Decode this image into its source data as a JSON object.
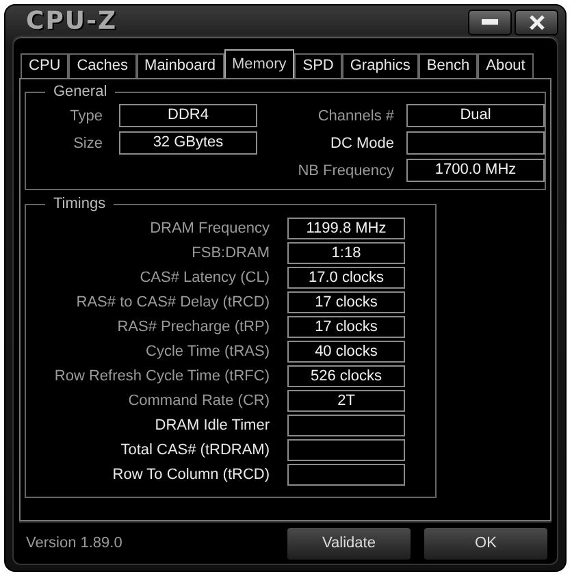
{
  "window": {
    "title": "CPU-Z"
  },
  "tabs": [
    {
      "label": "CPU",
      "selected": false
    },
    {
      "label": "Caches",
      "selected": false
    },
    {
      "label": "Mainboard",
      "selected": false
    },
    {
      "label": "Memory",
      "selected": true
    },
    {
      "label": "SPD",
      "selected": false
    },
    {
      "label": "Graphics",
      "selected": false
    },
    {
      "label": "Bench",
      "selected": false
    },
    {
      "label": "About",
      "selected": false
    }
  ],
  "general": {
    "title": "General",
    "left": [
      {
        "label": "Type",
        "value": "DDR4",
        "dimmed": true
      },
      {
        "label": "Size",
        "value": "32 GBytes",
        "dimmed": true
      }
    ],
    "right": [
      {
        "label": "Channels #",
        "value": "Dual",
        "dimmed": true
      },
      {
        "label": "DC Mode",
        "dimmed": false
      },
      {
        "label": "NB Frequency",
        "value": "1700.0 MHz",
        "dimmed": true
      }
    ]
  },
  "timings": {
    "title": "Timings",
    "rows": [
      {
        "label": "DRAM Frequency",
        "value": "1199.8 MHz",
        "dimmed": true
      },
      {
        "label": "FSB:DRAM",
        "value": "1:18",
        "dimmed": true
      },
      {
        "label": "CAS# Latency (CL)",
        "value": "17.0 clocks",
        "dimmed": true
      },
      {
        "label": "RAS# to CAS# Delay (tRCD)",
        "value": "17 clocks",
        "dimmed": true
      },
      {
        "label": "RAS# Precharge (tRP)",
        "value": "17 clocks",
        "dimmed": true
      },
      {
        "label": "Cycle Time (tRAS)",
        "value": "40 clocks",
        "dimmed": true
      },
      {
        "label": "Row Refresh Cycle Time (tRFC)",
        "value": "526 clocks",
        "dimmed": true
      },
      {
        "label": "Command Rate (CR)",
        "value": "2T",
        "dimmed": true
      },
      {
        "label": "DRAM Idle Timer",
        "dimmed": false
      },
      {
        "label": "Total CAS# (tRDRAM)",
        "dimmed": false
      },
      {
        "label": "Row To Column (tRCD)",
        "dimmed": false
      }
    ]
  },
  "footer": {
    "version": "Version 1.89.0",
    "buttons": [
      "Validate",
      "OK"
    ]
  }
}
